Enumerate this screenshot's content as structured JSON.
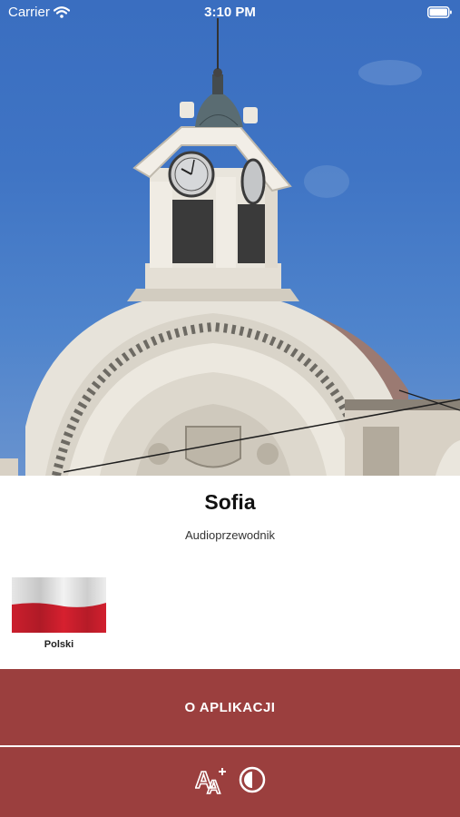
{
  "status_bar": {
    "carrier": "Carrier",
    "time": "3:10 PM"
  },
  "header": {
    "title": "Sofia",
    "subtitle": "Audioprzewodnik"
  },
  "languages": [
    {
      "label": "Polski",
      "flag": "poland-flag-icon"
    }
  ],
  "buttons": {
    "about_label": "O APLIKACJI"
  },
  "accessibility": {
    "icons": [
      "text-size-icon",
      "contrast-icon"
    ]
  },
  "colors": {
    "accent": "#9b3f3e",
    "sky": "#3f74c4",
    "background": "#ffffff"
  }
}
